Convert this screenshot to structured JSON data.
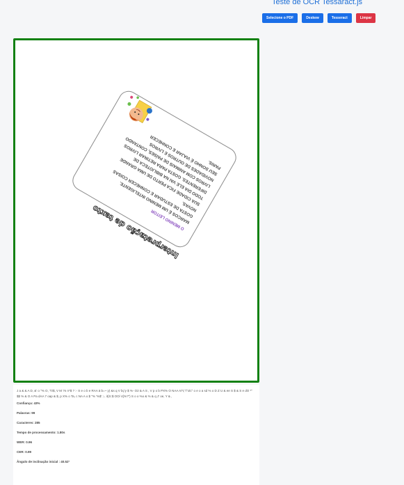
{
  "header": {
    "title": "Teste de OCR Tessaract.js"
  },
  "toolbar": {
    "select_pdf": "Selecione o PDF",
    "deskew": "Deskew",
    "tesseract": "Tesseract",
    "clear": "Limpar"
  },
  "colors": {
    "primary": "#1a6ee8",
    "danger": "#dc3545",
    "viewer_border": "#138113",
    "title": "#1f6fd6"
  },
  "viewer": {
    "card_heading": "Interpretação de texto",
    "card_subtitle": "O MENINO LEITOR",
    "card_lines": [
      "MARCOS É UM MENINO INTELIGENTE.",
      "GOSTA DE ESTUDAR E CONHECER COISAS",
      "NOVAS.",
      "SUA CIDADE FICA PERTO DE UMA GRANDE",
      "TODO DIA ELE VAI NA BIBLIOTECA DE",
      "DIFERENTES. GOSTA PARA RETIRAR LIVROS",
      "LIVROS COM ANIMAIS DE PAÍSES, CONTANDO",
      "NOVIDADES DE OUTROS E LIVROS",
      "SEU SONHO É VIAJAR E CONHECER",
      "PARIS."
    ]
  },
  "results": {
    "ocr_text": "J a & & A D, &' o \"% O, ?\\/$, V M ?n n*$ ? :- S e o b e RAA ä b=~ y) &s q V bç'y $ %- O2 & A S , V p o b PX% O NAA Ai*t,\"/\"olc\" o e o a sd % o D Z U & ee S $ & S e dO *\" $$ % & O A Pa dAA 7 oap & $, p X% o Ta, c NA A o $ \"% '%$' ;-, it{S:$ OO/ 4{%?\") S o o %o & % & q J' oe, Y & ,",
    "confidence": "Confiança: 43%",
    "words": "Palavras: 99",
    "characters": "Caracteres: 285",
    "processing_time": "Tempo de processamento: 1.80s",
    "wer": "WER: 0.96",
    "cer": "CER: 0.99",
    "skew_angle": "Ângulo de inclinação inicial : 40.52°"
  }
}
